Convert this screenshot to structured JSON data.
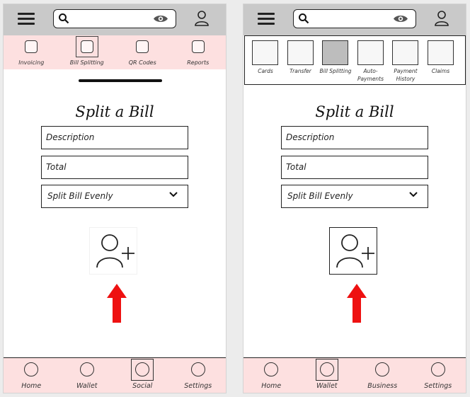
{
  "left": {
    "tabs": [
      {
        "label": "Invoicing",
        "active": false
      },
      {
        "label": "Bill Splitting",
        "active": true
      },
      {
        "label": "QR Codes",
        "active": false
      },
      {
        "label": "Reports",
        "active": false
      }
    ],
    "title": "Split a Bill",
    "fields": {
      "description": "Description",
      "total": "Total",
      "split": "Split Bill Evenly"
    },
    "bottom_nav": [
      {
        "label": "Home",
        "active": false
      },
      {
        "label": "Wallet",
        "active": false
      },
      {
        "label": "Social",
        "active": true
      },
      {
        "label": "Settings",
        "active": false
      }
    ]
  },
  "right": {
    "tabs": [
      {
        "label": "Cards",
        "active": false
      },
      {
        "label": "Transfer",
        "active": false
      },
      {
        "label": "Bill Splitting",
        "active": true
      },
      {
        "label": "Auto-Payments",
        "active": false
      },
      {
        "label": "Payment History",
        "active": false
      },
      {
        "label": "Claims",
        "active": false
      }
    ],
    "title": "Split a Bill",
    "fields": {
      "description": "Description",
      "total": "Total",
      "split": "Split Bill Evenly"
    },
    "bottom_nav": [
      {
        "label": "Home",
        "active": false
      },
      {
        "label": "Wallet",
        "active": true
      },
      {
        "label": "Business",
        "active": false
      },
      {
        "label": "Settings",
        "active": false
      }
    ]
  },
  "icons": {
    "menu": "hamburger-menu-icon",
    "search": "search-icon",
    "visibility": "eye-icon",
    "profile": "user-icon",
    "add_person": "add-person-icon",
    "pointer": "red-up-arrow-icon"
  },
  "colors": {
    "topbar": "#c9c9c9",
    "tab_strip": "#fde0e0",
    "active_tile": "#bdbdbd",
    "arrow": "#ee1111"
  }
}
